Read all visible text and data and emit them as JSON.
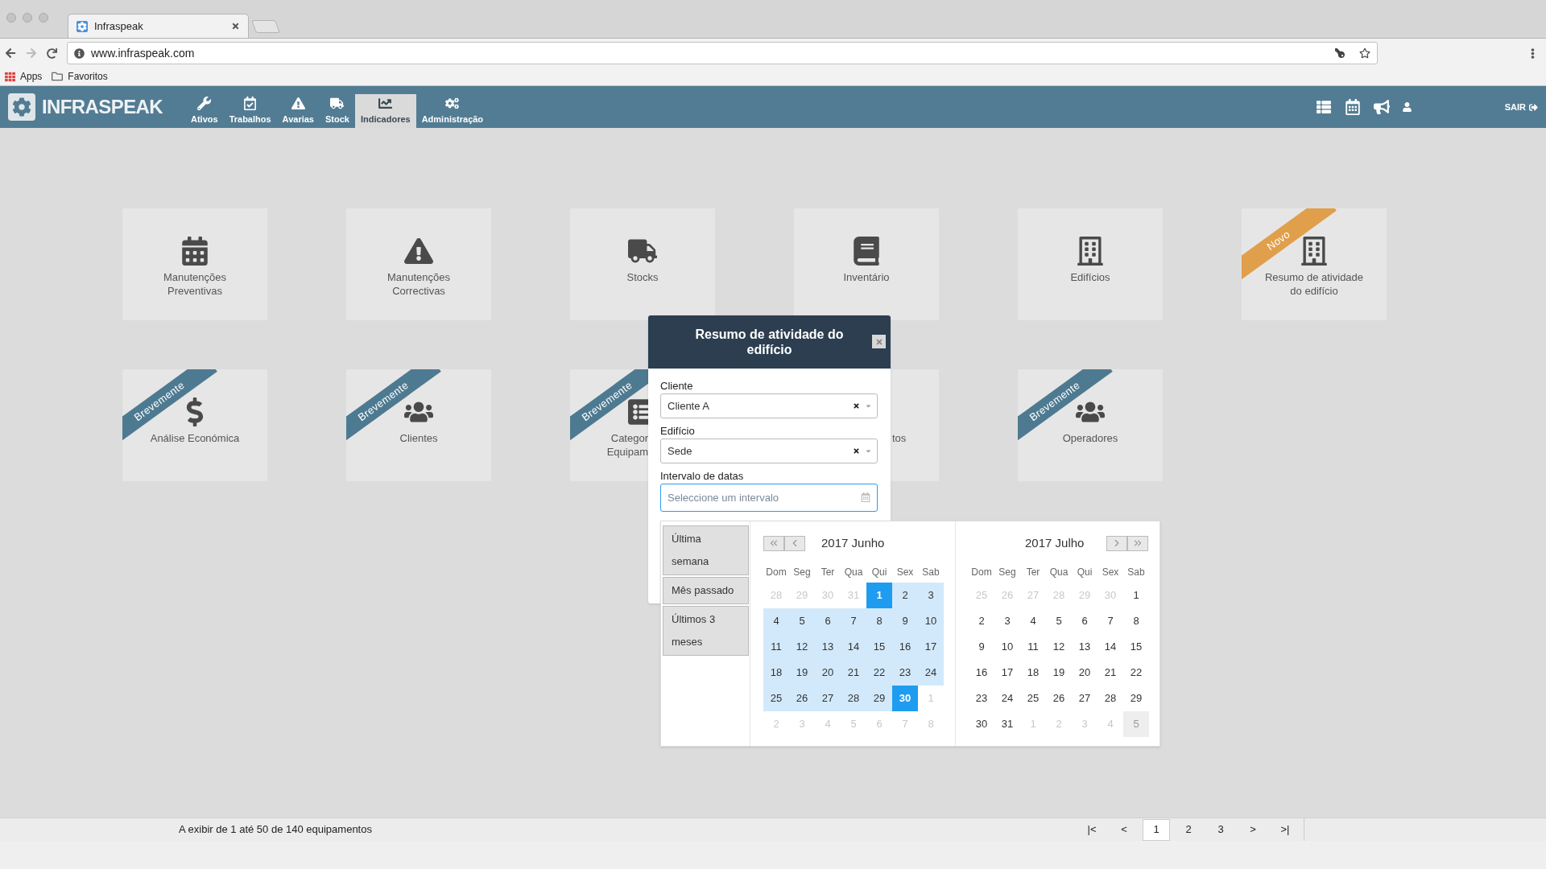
{
  "browser": {
    "tab": {
      "title": "Infraspeak"
    },
    "url": "www.infraspeak.com",
    "bookmarks": [
      "Apps",
      "Favoritos"
    ]
  },
  "nav": {
    "brand": "INFRASPEAK",
    "items": [
      {
        "label": "Ativos",
        "selected": false
      },
      {
        "label": "Trabalhos",
        "selected": false
      },
      {
        "label": "Avarias",
        "selected": false
      },
      {
        "label": "Stock",
        "selected": false
      },
      {
        "label": "Indicadores",
        "selected": true
      },
      {
        "label": "Administração",
        "selected": false
      }
    ],
    "logout": "SAIR"
  },
  "cards": [
    {
      "lines": [
        "Manutenções",
        "Preventivas"
      ],
      "kind": "full"
    },
    {
      "lines": [
        "Manutenções",
        "Correctivas"
      ],
      "kind": "full"
    },
    {
      "lines": [
        "Stocks"
      ],
      "kind": "full"
    },
    {
      "lines": [
        "Inventário"
      ],
      "kind": "full"
    },
    {
      "lines": [
        "Edifícios"
      ],
      "kind": "full"
    },
    {
      "lines": [
        "Resumo de atividade",
        "do edifício"
      ],
      "kind": "full",
      "ribbon": "Novo"
    },
    {
      "lines": [
        "Análise Económica"
      ],
      "kind": "full",
      "ribbon": "Brevemente"
    },
    {
      "lines": [
        "Clientes"
      ],
      "kind": "full",
      "ribbon": "Brevemente"
    },
    {
      "lines": [
        "Categor",
        "Equipam"
      ],
      "kind": "cut_right",
      "ribbon": "Brevemente"
    },
    {
      "lines": [
        "tos"
      ],
      "kind": "cut_left"
    },
    {
      "lines": [
        "Operadores"
      ],
      "kind": "full",
      "ribbon": "Brevemente"
    }
  ],
  "modal": {
    "title": "Resumo de atividade do edifício",
    "fields": [
      {
        "label": "Cliente",
        "kind": "select",
        "value": "Cliente A"
      },
      {
        "label": "Edifício",
        "kind": "select",
        "value": "Sede"
      },
      {
        "label": "Intervalo de datas",
        "kind": "date",
        "placeholder": "Seleccione um intervalo"
      }
    ]
  },
  "datepicker": {
    "ranges": [
      "Última semana",
      "Mês passado",
      "Últimos 3 meses"
    ],
    "months": [
      {
        "title": "2017 Junho",
        "weekdays": [
          "Dom",
          "Seg",
          "Ter",
          "Qua",
          "Qui",
          "Sex",
          "Sab"
        ],
        "weeks": [
          [
            {
              "label": "28",
              "kind": "off"
            },
            {
              "label": "29",
              "kind": "off"
            },
            {
              "label": "30",
              "kind": "off"
            },
            {
              "label": "31",
              "kind": "off"
            },
            {
              "label": "1",
              "kind": "edge"
            },
            {
              "label": "2",
              "kind": "range"
            },
            {
              "label": "3",
              "kind": "range"
            }
          ],
          [
            {
              "label": "4",
              "kind": "range"
            },
            {
              "label": "5",
              "kind": "range"
            },
            {
              "label": "6",
              "kind": "range"
            },
            {
              "label": "7",
              "kind": "range"
            },
            {
              "label": "8",
              "kind": "range"
            },
            {
              "label": "9",
              "kind": "range"
            },
            {
              "label": "10",
              "kind": "range"
            }
          ],
          [
            {
              "label": "11",
              "kind": "range"
            },
            {
              "label": "12",
              "kind": "range"
            },
            {
              "label": "13",
              "kind": "range"
            },
            {
              "label": "14",
              "kind": "range"
            },
            {
              "label": "15",
              "kind": "range"
            },
            {
              "label": "16",
              "kind": "range"
            },
            {
              "label": "17",
              "kind": "range"
            }
          ],
          [
            {
              "label": "18",
              "kind": "range"
            },
            {
              "label": "19",
              "kind": "range"
            },
            {
              "label": "20",
              "kind": "range"
            },
            {
              "label": "21",
              "kind": "range"
            },
            {
              "label": "22",
              "kind": "range"
            },
            {
              "label": "23",
              "kind": "range"
            },
            {
              "label": "24",
              "kind": "range"
            }
          ],
          [
            {
              "label": "25",
              "kind": "range"
            },
            {
              "label": "26",
              "kind": "range"
            },
            {
              "label": "27",
              "kind": "range"
            },
            {
              "label": "28",
              "kind": "range"
            },
            {
              "label": "29",
              "kind": "range"
            },
            {
              "label": "30",
              "kind": "edge"
            },
            {
              "label": "1",
              "kind": "off"
            }
          ],
          [
            {
              "label": "2",
              "kind": "off"
            },
            {
              "label": "3",
              "kind": "off"
            },
            {
              "label": "4",
              "kind": "off"
            },
            {
              "label": "5",
              "kind": "off"
            },
            {
              "label": "6",
              "kind": "off"
            },
            {
              "label": "7",
              "kind": "off"
            },
            {
              "label": "8",
              "kind": "off"
            }
          ]
        ]
      },
      {
        "title": "2017 Julho",
        "weekdays": [
          "Dom",
          "Seg",
          "Ter",
          "Qua",
          "Qui",
          "Sex",
          "Sab"
        ],
        "weeks": [
          [
            {
              "label": "25",
              "kind": "off"
            },
            {
              "label": "26",
              "kind": "off"
            },
            {
              "label": "27",
              "kind": "off"
            },
            {
              "label": "28",
              "kind": "off"
            },
            {
              "label": "29",
              "kind": "off"
            },
            {
              "label": "30",
              "kind": "off"
            },
            {
              "label": "1",
              "kind": "day"
            }
          ],
          [
            {
              "label": "2",
              "kind": "day"
            },
            {
              "label": "3",
              "kind": "day"
            },
            {
              "label": "4",
              "kind": "day"
            },
            {
              "label": "5",
              "kind": "day"
            },
            {
              "label": "6",
              "kind": "day"
            },
            {
              "label": "7",
              "kind": "day"
            },
            {
              "label": "8",
              "kind": "day"
            }
          ],
          [
            {
              "label": "9",
              "kind": "day"
            },
            {
              "label": "10",
              "kind": "day"
            },
            {
              "label": "11",
              "kind": "day"
            },
            {
              "label": "12",
              "kind": "day"
            },
            {
              "label": "13",
              "kind": "day"
            },
            {
              "label": "14",
              "kind": "day"
            },
            {
              "label": "15",
              "kind": "day"
            }
          ],
          [
            {
              "label": "16",
              "kind": "day"
            },
            {
              "label": "17",
              "kind": "day"
            },
            {
              "label": "18",
              "kind": "day"
            },
            {
              "label": "19",
              "kind": "day"
            },
            {
              "label": "20",
              "kind": "day"
            },
            {
              "label": "21",
              "kind": "day"
            },
            {
              "label": "22",
              "kind": "day"
            }
          ],
          [
            {
              "label": "23",
              "kind": "day"
            },
            {
              "label": "24",
              "kind": "day"
            },
            {
              "label": "25",
              "kind": "day"
            },
            {
              "label": "26",
              "kind": "day"
            },
            {
              "label": "27",
              "kind": "day"
            },
            {
              "label": "28",
              "kind": "day"
            },
            {
              "label": "29",
              "kind": "day"
            }
          ],
          [
            {
              "label": "30",
              "kind": "day"
            },
            {
              "label": "31",
              "kind": "day"
            },
            {
              "label": "1",
              "kind": "off"
            },
            {
              "label": "2",
              "kind": "off"
            },
            {
              "label": "3",
              "kind": "off"
            },
            {
              "label": "4",
              "kind": "off"
            },
            {
              "label": "5",
              "kind": "hover"
            }
          ]
        ]
      }
    ]
  },
  "footer": {
    "summary": "A exibir de 1 até 50 de 140 equipamentos",
    "pages": [
      {
        "label": "|<",
        "selected": false
      },
      {
        "label": "<",
        "selected": false
      },
      {
        "label": "1",
        "selected": true
      },
      {
        "label": "2",
        "selected": false
      },
      {
        "label": "3",
        "selected": false
      },
      {
        "label": ">",
        "selected": false
      },
      {
        "label": ">|",
        "selected": false
      }
    ]
  }
}
